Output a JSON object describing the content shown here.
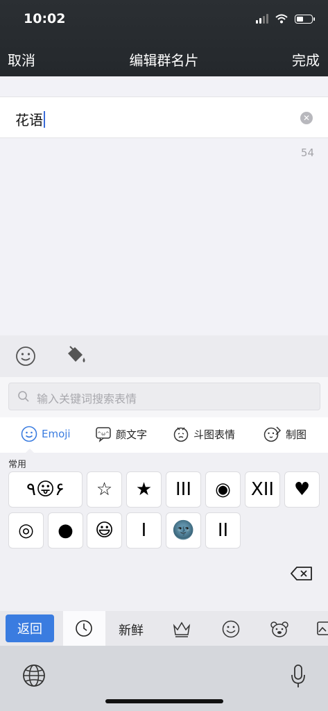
{
  "status": {
    "time": "10:02"
  },
  "nav": {
    "cancel": "取消",
    "title": "编辑群名片",
    "done": "完成"
  },
  "input": {
    "value": "花语",
    "counter": "54"
  },
  "search": {
    "placeholder": "输入关键词搜索表情"
  },
  "tabs": [
    {
      "label": "Emoji",
      "icon": "smiley-icon",
      "active": true
    },
    {
      "label": "颜文字",
      "icon": "kaomoji-icon"
    },
    {
      "label": "斗图表情",
      "icon": "meme-face-icon"
    },
    {
      "label": "制图",
      "icon": "draw-face-icon"
    }
  ],
  "section": {
    "label": "常用"
  },
  "keys": [
    {
      "text": "٩😛۶",
      "type": "text"
    },
    {
      "text": "☆",
      "type": "text"
    },
    {
      "text": "★",
      "type": "text"
    },
    {
      "text": "III",
      "type": "text"
    },
    {
      "text": "◉",
      "type": "text"
    },
    {
      "text": "XII",
      "type": "text"
    },
    {
      "text": "♥",
      "type": "text"
    },
    {
      "text": "◎",
      "type": "text"
    },
    {
      "text": "●",
      "type": "text"
    },
    {
      "text": "😃",
      "type": "emoji"
    },
    {
      "text": "I",
      "type": "text"
    },
    {
      "text": "🌚",
      "type": "emoji"
    },
    {
      "text": "II",
      "type": "text"
    }
  ],
  "bottom": {
    "back": "返回",
    "fresh": "新鲜"
  },
  "colors": {
    "accent": "#3a7ce0",
    "header": "#2b2f33"
  }
}
